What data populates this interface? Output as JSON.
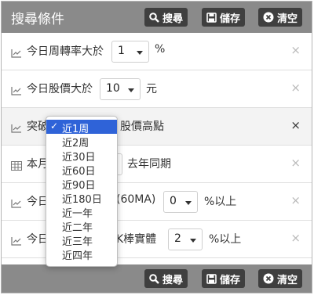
{
  "header": {
    "title": "搜尋條件",
    "search_label": "搜尋",
    "save_label": "儲存",
    "clear_label": "清空"
  },
  "footer": {
    "search_label": "搜尋",
    "save_label": "儲存",
    "clear_label": "清空"
  },
  "rows": [
    {
      "icon": "line-chart-icon",
      "pre": "今日周轉率大於",
      "value": "1",
      "post": "%"
    },
    {
      "icon": "line-chart-icon",
      "pre": "今日股價大於",
      "value": "10",
      "post": "元"
    },
    {
      "icon": "line-chart-icon",
      "pre": "突破",
      "value": "近1周",
      "post": "股價高點"
    },
    {
      "icon": "table-icon",
      "pre": "本月",
      "value": "",
      "post": "去年同期"
    },
    {
      "icon": "line-chart-icon",
      "pre": "今日",
      "value": "0",
      "mid": "(60MA)",
      "post": "%以上"
    },
    {
      "icon": "line-chart-icon",
      "pre": "今日",
      "value": "2",
      "mid": "K棒實體",
      "post": "%以上"
    }
  ],
  "dropdown": {
    "options": [
      "近1周",
      "近2周",
      "近30日",
      "近60日",
      "近90日",
      "近180日",
      "近一年",
      "近二年",
      "近三年",
      "近四年"
    ],
    "selected": "近1周"
  },
  "close_glyph": "×",
  "colors": {
    "header_bg": "#8a8a8a",
    "button_bg": "#3f3f3f",
    "selected_option": "#2f63d8"
  }
}
